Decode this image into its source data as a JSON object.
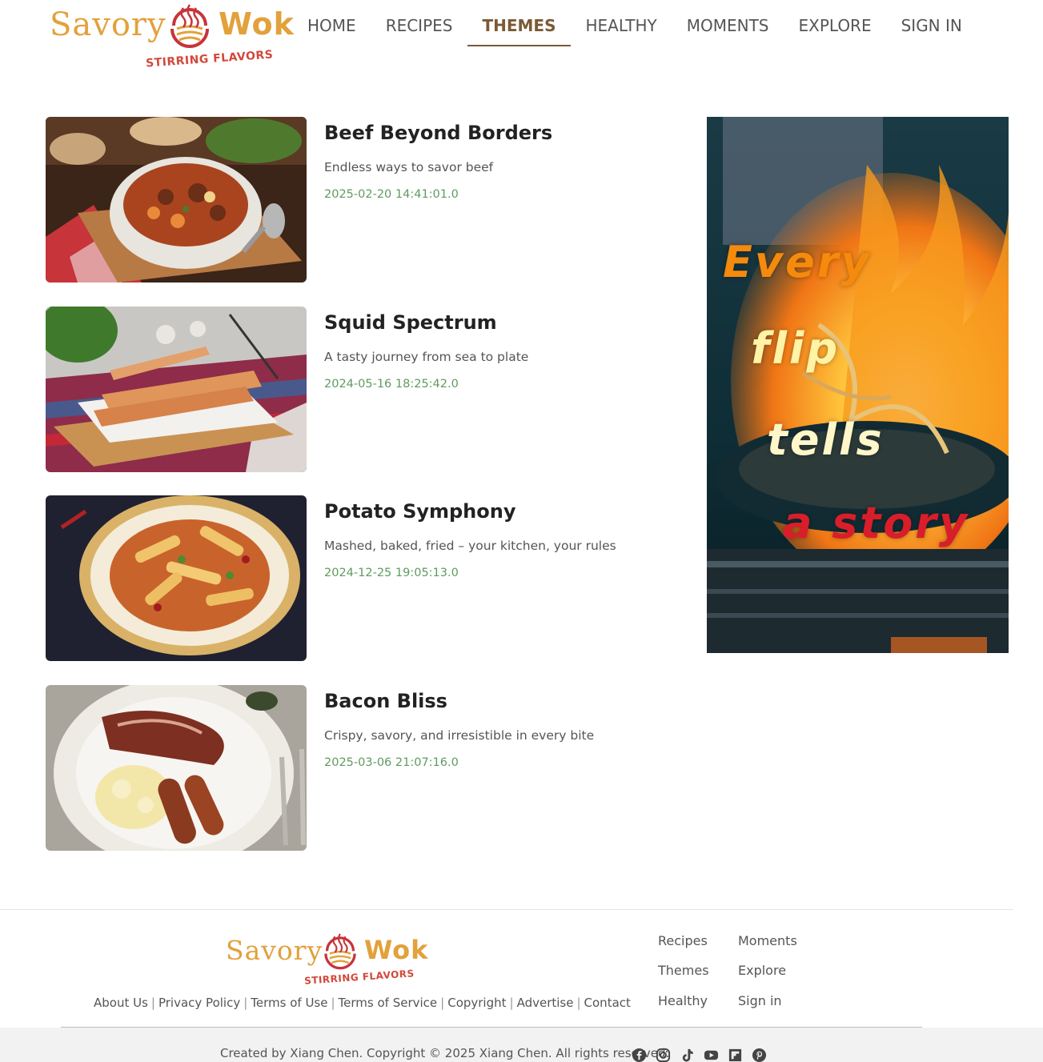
{
  "brand": {
    "name_left": "Savory",
    "name_right": "Wok",
    "tagline": "STIRRING FLAVORS"
  },
  "nav": {
    "items": [
      {
        "label": "HOME",
        "active": false
      },
      {
        "label": "RECIPES",
        "active": false
      },
      {
        "label": "THEMES",
        "active": true
      },
      {
        "label": "HEALTHY",
        "active": false
      },
      {
        "label": "MOMENTS",
        "active": false
      },
      {
        "label": "EXPLORE",
        "active": false
      },
      {
        "label": "SIGN IN",
        "active": false
      }
    ]
  },
  "articles": [
    {
      "title": "Beef Beyond Borders",
      "description": "Endless ways to savor beef",
      "date": "2025-02-20 14:41:01.0",
      "image": "beef-stew-image"
    },
    {
      "title": "Squid Spectrum",
      "description": "A tasty journey from sea to plate",
      "date": "2024-05-16 18:25:42.0",
      "image": "grilled-squid-image"
    },
    {
      "title": "Potato Symphony",
      "description": "Mashed, baked, fried – your kitchen, your rules",
      "date": "2024-12-25 19:05:13.0",
      "image": "fried-potato-image"
    },
    {
      "title": "Bacon Bliss",
      "description": "Crispy, savory, and irresistible in every bite",
      "date": "2025-03-06 21:07:16.0",
      "image": "bacon-breakfast-image"
    }
  ],
  "banner": {
    "lines": [
      "Every",
      "flip",
      "tells",
      "a story"
    ],
    "colors": [
      "#f58a0c",
      "#fff3a6",
      "#fff6c9",
      "#d81e2a"
    ]
  },
  "footer": {
    "links": [
      "About Us",
      "Privacy Policy",
      "Terms of Use",
      "Terms of Service",
      "Copyright",
      "Advertise",
      "Contact"
    ],
    "nav_col1": [
      "Recipes",
      "Themes",
      "Healthy"
    ],
    "nav_col2": [
      "Moments",
      "Explore",
      "Sign in"
    ],
    "copyright": "Created by Xiang Chen. Copyright © 2025 Xiang Chen. All rights reserved.",
    "socials": [
      "facebook-icon",
      "instagram-icon",
      "tiktok-icon",
      "youtube-icon",
      "flipboard-icon",
      "pinterest-icon"
    ]
  },
  "colors": {
    "brand_gold": "#e2a13b",
    "brand_red": "#d3473a",
    "nav_active": "#7a5a35",
    "date_green": "#5f9b5f"
  }
}
